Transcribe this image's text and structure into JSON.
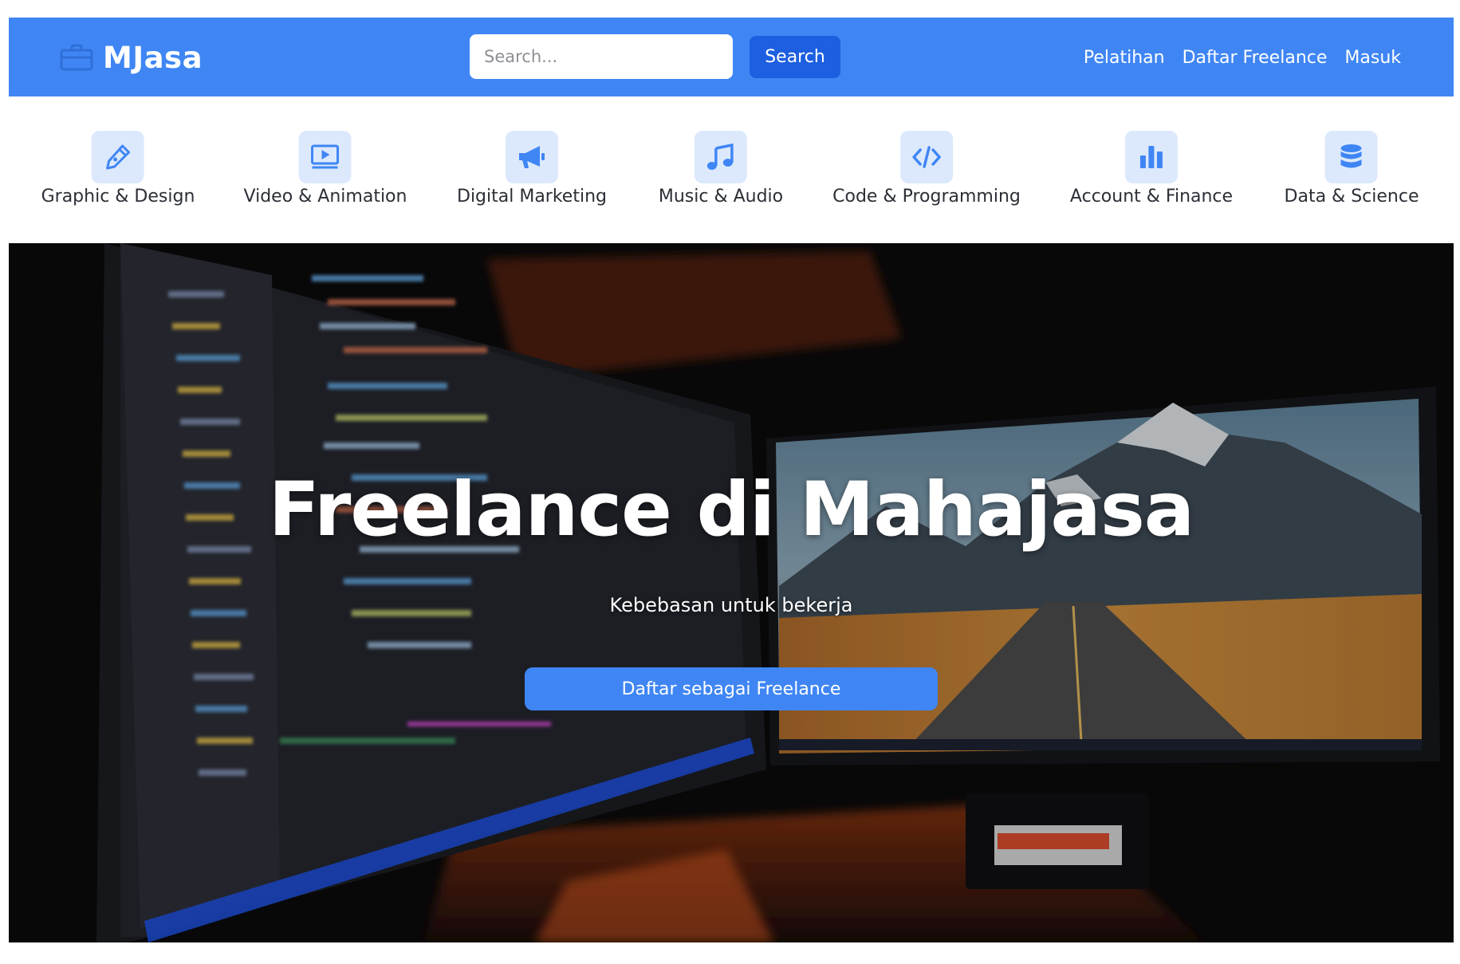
{
  "brand": {
    "name": "MJasa",
    "icon": "briefcase-icon"
  },
  "search": {
    "placeholder": "Search...",
    "value": "",
    "button_label": "Search"
  },
  "nav": {
    "links": [
      {
        "label": "Pelatihan"
      },
      {
        "label": "Daftar Freelance"
      },
      {
        "label": "Masuk"
      }
    ]
  },
  "categories": [
    {
      "label": "Graphic & Design",
      "icon": "pen-icon"
    },
    {
      "label": "Video & Animation",
      "icon": "video-icon"
    },
    {
      "label": "Digital Marketing",
      "icon": "megaphone-icon"
    },
    {
      "label": "Music & Audio",
      "icon": "music-note-icon"
    },
    {
      "label": "Code & Programming",
      "icon": "code-icon"
    },
    {
      "label": "Account & Finance",
      "icon": "bar-chart-icon"
    },
    {
      "label": "Data & Science",
      "icon": "database-icon"
    }
  ],
  "hero": {
    "title": "Freelance di Mahajasa",
    "subtitle": "Kebebasan untuk bekerja",
    "cta_label": "Daftar sebagai Freelance"
  },
  "colors": {
    "primary": "#3f86f4",
    "primary_dark": "#1d5fe0",
    "icon_bg": "#dce9fd",
    "text": "#2b2f36"
  }
}
